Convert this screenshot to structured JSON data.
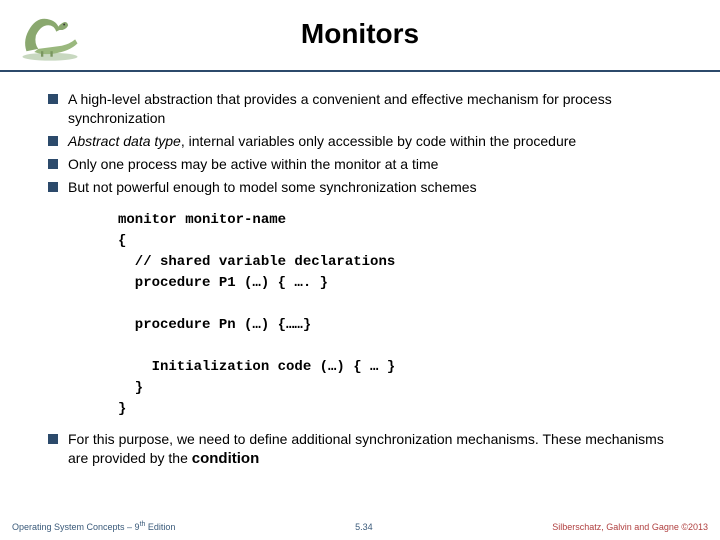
{
  "title": "Monitors",
  "bullets": [
    "A high-level abstraction that provides a convenient and effective mechanism for process synchronization",
    "Abstract data type, internal variables only accessible by code within the procedure",
    "Only one process may be active within the monitor at a time",
    "But not powerful enough to model some synchronization schemes"
  ],
  "code": {
    "l1": "monitor monitor-name",
    "l2": "{",
    "l3": "  // shared variable declarations",
    "l4": "  procedure P1 (…) { …. }",
    "l5": "",
    "l6": "  procedure Pn (…) {……}",
    "l7": "",
    "l8": "    Initialization code (…) { … }",
    "l9": "  }",
    "l10": "}"
  },
  "bullet2_prefix": "For this purpose, we need to define additional synchronization mechanisms. These mechanisms are provided by the ",
  "bullet2_strong": "condition",
  "footer": {
    "left_a": "Operating System Concepts – 9",
    "left_sup": "th",
    "left_b": " Edition",
    "center": "5.34",
    "right": "Silberschatz, Galvin and Gagne ©2013"
  }
}
